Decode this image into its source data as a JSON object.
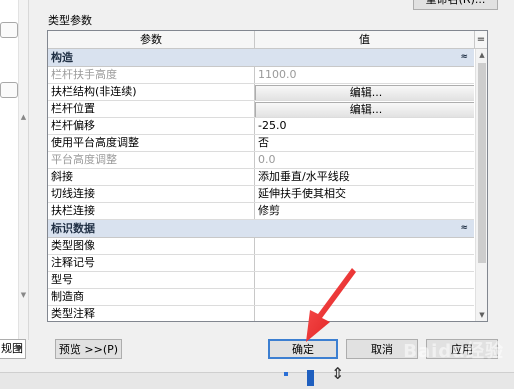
{
  "dialog": {
    "top_button_label": "重命名(R)...",
    "section_title": "类型参数",
    "columns": {
      "param": "参数",
      "value": "值",
      "eq": "="
    }
  },
  "groups": [
    {
      "label": "构造",
      "toggle": "≈",
      "rows": [
        {
          "name": "栏杆扶手高度",
          "value": "1100.0",
          "disabled": true
        },
        {
          "name": "扶栏结构(非连续)",
          "value": "编辑...",
          "button": true
        },
        {
          "name": "栏杆位置",
          "value": "编辑...",
          "button": true
        },
        {
          "name": "栏杆偏移",
          "value": "-25.0"
        },
        {
          "name": "使用平台高度调整",
          "value": "否"
        },
        {
          "name": "平台高度调整",
          "value": "0.0",
          "disabled": true
        },
        {
          "name": "斜接",
          "value": "添加垂直/水平线段"
        },
        {
          "name": "切线连接",
          "value": "延伸扶手使其相交"
        },
        {
          "name": "扶栏连接",
          "value": "修剪"
        }
      ]
    },
    {
      "label": "标识数据",
      "toggle": "≈",
      "rows": [
        {
          "name": "类型图像",
          "value": ""
        },
        {
          "name": "注释记号",
          "value": ""
        },
        {
          "name": "型号",
          "value": ""
        },
        {
          "name": "制造商",
          "value": ""
        },
        {
          "name": "类型注释",
          "value": ""
        }
      ]
    }
  ],
  "footer": {
    "view_label": "规图",
    "preview_label": "预览 >>(P)",
    "ok_label": "确定",
    "cancel_label": "取消",
    "apply_label": "应用"
  },
  "watermark": "Baidu经验"
}
